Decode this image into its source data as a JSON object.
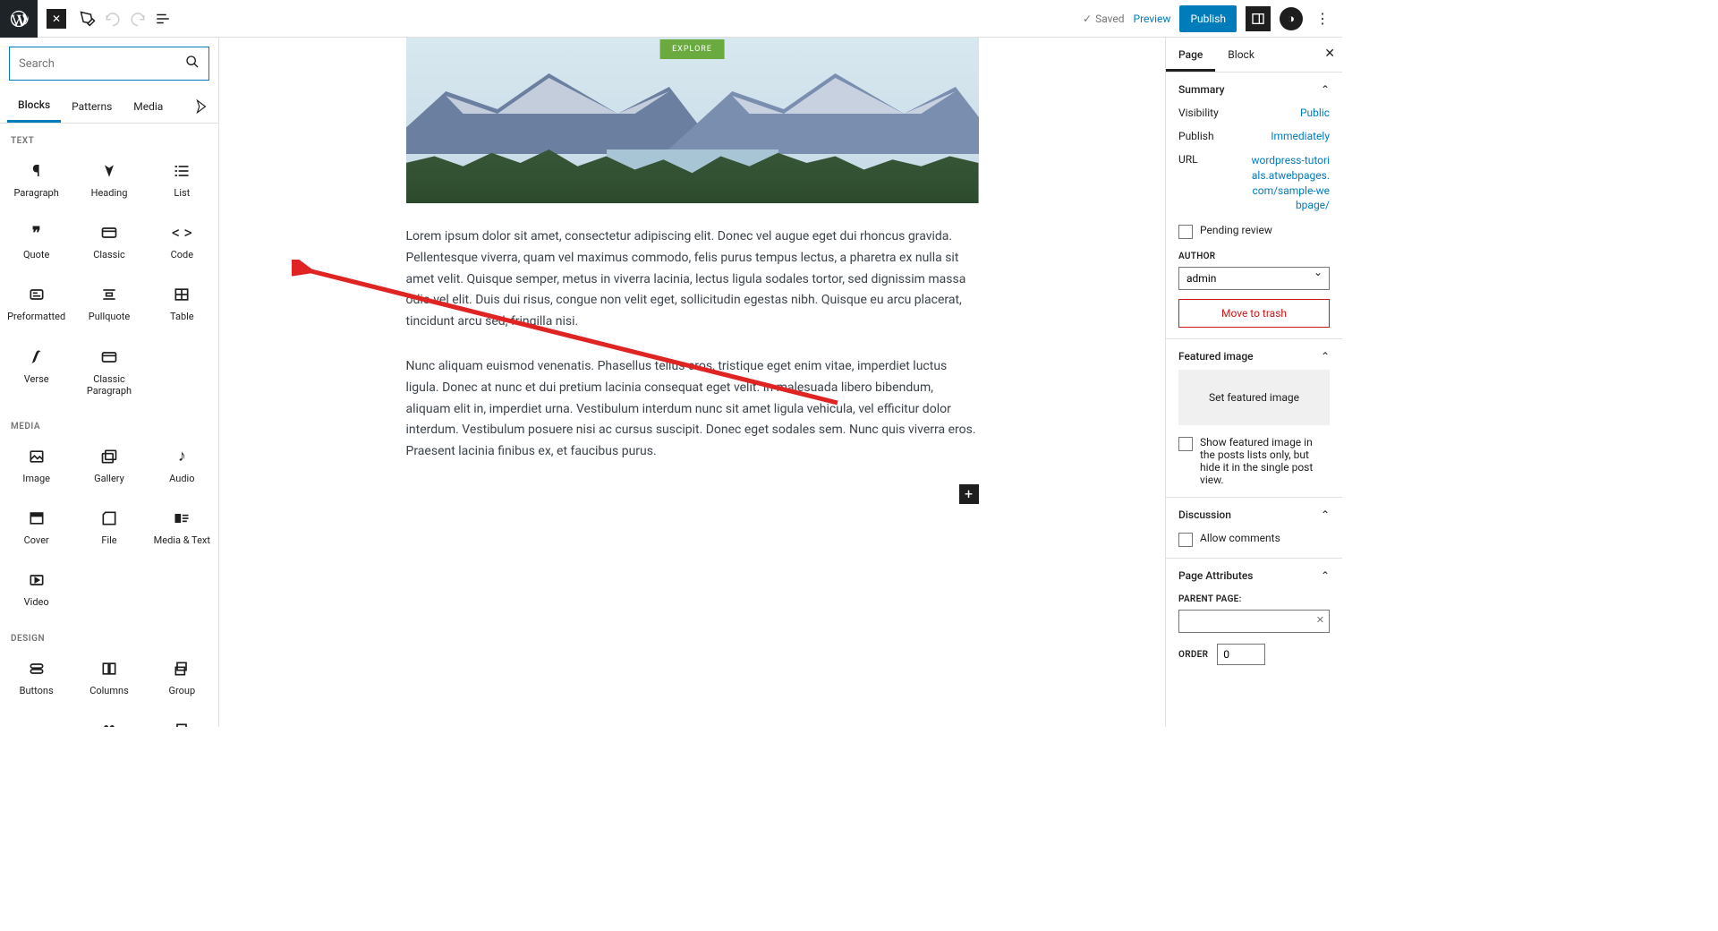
{
  "topbar": {
    "saved": "Saved",
    "preview": "Preview",
    "publish": "Publish"
  },
  "inserter": {
    "search_placeholder": "Search",
    "tabs": {
      "blocks": "Blocks",
      "patterns": "Patterns",
      "media": "Media"
    },
    "cat_text": "TEXT",
    "cat_media": "MEDIA",
    "cat_design": "DESIGN",
    "blocks": {
      "paragraph": "Paragraph",
      "heading": "Heading",
      "list": "List",
      "quote": "Quote",
      "classic": "Classic",
      "code": "Code",
      "preformatted": "Preformatted",
      "pullquote": "Pullquote",
      "table": "Table",
      "verse": "Verse",
      "classic_paragraph": "Classic Paragraph",
      "image": "Image",
      "gallery": "Gallery",
      "audio": "Audio",
      "cover": "Cover",
      "file": "File",
      "media_text": "Media & Text",
      "video": "Video",
      "buttons": "Buttons",
      "columns": "Columns",
      "group": "Group"
    }
  },
  "content": {
    "explore": "EXPLORE",
    "para1": "Lorem ipsum dolor sit amet, consectetur adipiscing elit. Donec vel augue eget dui rhoncus gravida. Pellentesque viverra, quam vel maximus commodo, felis purus tempus lectus, a pharetra ex nulla sit amet velit. Quisque semper, metus in viverra lacinia, lectus ligula sodales tortor, sed dignissim massa odio vel elit. Duis dui risus, congue non velit eget, sollicitudin egestas nibh. Quisque eu arcu placerat, tincidunt arcu sed, fringilla nisi.",
    "para2": "Nunc aliquam euismod venenatis. Phasellus tellus eros, tristique eget enim vitae, imperdiet luctus ligula. Donec at nunc et dui pretium lacinia consequat eget velit. In malesuada libero bibendum, aliquam elit in, imperdiet urna. Vestibulum interdum nunc sit amet ligula vehicula, vel efficitur dolor interdum. Vestibulum posuere nisi ac cursus suscipit. Donec eget sodales sem. Nunc quis viverra eros. Praesent lacinia finibus ex, et faucibus purus."
  },
  "sidebar": {
    "tabs": {
      "page": "Page",
      "block": "Block"
    },
    "summary": {
      "title": "Summary",
      "visibility_lbl": "Visibility",
      "visibility_val": "Public",
      "publish_lbl": "Publish",
      "publish_val": "Immediately",
      "url_lbl": "URL",
      "url_val": "wordpress-tutorials.atwebpages.com/sample-webpage/",
      "pending": "Pending review",
      "author_lbl": "AUTHOR",
      "author_val": "admin",
      "trash": "Move to trash"
    },
    "featured": {
      "title": "Featured image",
      "button": "Set featured image",
      "hide": "Show featured image in the posts lists only, but hide it in the single post view."
    },
    "discussion": {
      "title": "Discussion",
      "allow": "Allow comments"
    },
    "attrs": {
      "title": "Page Attributes",
      "parent_lbl": "PARENT PAGE:",
      "order_lbl": "ORDER",
      "order_val": "0"
    }
  }
}
